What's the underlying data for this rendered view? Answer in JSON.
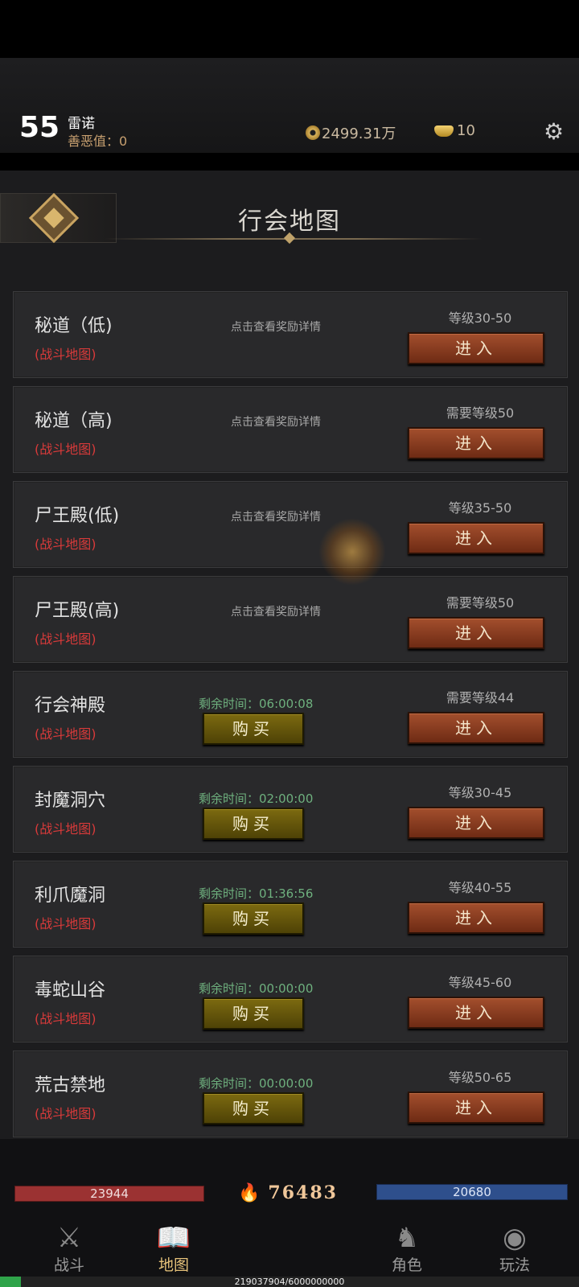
{
  "player": {
    "level": "55",
    "name": "雷诺",
    "karma": "善恶值：0"
  },
  "currency": {
    "coins": "2499.31万",
    "ingots": "10"
  },
  "page": {
    "title": "行会地图"
  },
  "maps": [
    {
      "name": "秘道（低)",
      "type": "(战斗地图)",
      "reward": "点击查看奖励详情",
      "timer": "",
      "buy": "",
      "level": "等级30-50",
      "enter": "进入"
    },
    {
      "name": "秘道（高)",
      "type": "(战斗地图)",
      "reward": "点击查看奖励详情",
      "timer": "",
      "buy": "",
      "level": "需要等级50",
      "enter": "进入"
    },
    {
      "name": "尸王殿(低)",
      "type": "(战斗地图)",
      "reward": "点击查看奖励详情",
      "timer": "",
      "buy": "",
      "level": "等级35-50",
      "enter": "进入"
    },
    {
      "name": "尸王殿(高)",
      "type": "(战斗地图)",
      "reward": "点击查看奖励详情",
      "timer": "",
      "buy": "",
      "level": "需要等级50",
      "enter": "进入"
    },
    {
      "name": "行会神殿",
      "type": "(战斗地图)",
      "reward": "",
      "timer": "剩余时间：06:00:08",
      "buy": "购买",
      "level": "需要等级44",
      "enter": "进入"
    },
    {
      "name": "封魔洞穴",
      "type": "(战斗地图)",
      "reward": "",
      "timer": "剩余时间：02:00:00",
      "buy": "购买",
      "level": "等级30-45",
      "enter": "进入"
    },
    {
      "name": "利爪魔洞",
      "type": "(战斗地图)",
      "reward": "",
      "timer": "剩余时间：01:36:56",
      "buy": "购买",
      "level": "等级40-55",
      "enter": "进入"
    },
    {
      "name": "毒蛇山谷",
      "type": "(战斗地图)",
      "reward": "",
      "timer": "剩余时间：00:00:00",
      "buy": "购买",
      "level": "等级45-60",
      "enter": "进入"
    },
    {
      "name": "荒古禁地",
      "type": "(战斗地图)",
      "reward": "",
      "timer": "剩余时间：00:00:00",
      "buy": "购买",
      "level": "等级50-65",
      "enter": "进入"
    }
  ],
  "stats": {
    "hp": "23944",
    "power": "76483",
    "mp": "20680"
  },
  "nav": [
    {
      "label": "战斗",
      "icon": "crossed-swords-icon",
      "glyph": "⚔"
    },
    {
      "label": "地图",
      "icon": "book-map-icon",
      "glyph": "📖"
    },
    {
      "label": "角色",
      "icon": "character-icon",
      "glyph": "♞"
    },
    {
      "label": "玩法",
      "icon": "eye-gameplay-icon",
      "glyph": "◉"
    }
  ],
  "exp": {
    "text": "219037904/6000000000",
    "fraction": 0.0365
  },
  "colors": {
    "enter_button": "#8b3c1f",
    "buy_button": "#6a5a0c",
    "map_type": "#d83a3a",
    "timer": "#6eb07e",
    "active_nav": "#e6c27a"
  }
}
